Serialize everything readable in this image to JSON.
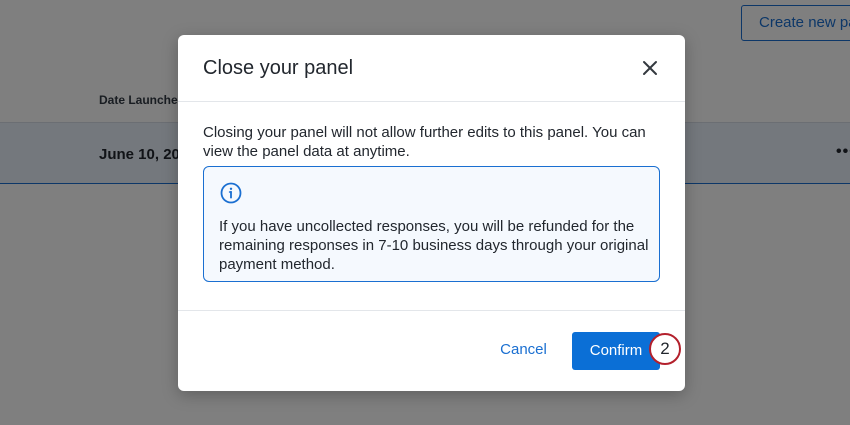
{
  "background": {
    "create_button_label": "Create new pa",
    "column_header": "Date Launche",
    "row_date": "June 10, 20",
    "row_more_label": "•••"
  },
  "modal": {
    "title": "Close your panel",
    "close_icon": "close-x-icon",
    "message": "Closing your panel will not allow further edits to this panel. You can view the panel data at anytime.",
    "info": {
      "icon": "info-circle-icon",
      "text": "If you have uncollected responses, you will be refunded for the remaining responses in 7-10 business days through your original payment method."
    },
    "cancel_label": "Cancel",
    "confirm_label": "Confirm"
  },
  "step_badge": "2",
  "colors": {
    "accent": "#0b6fd6",
    "badge_border": "#b3202c",
    "info_background": "#f5f9fe",
    "row_highlight": "#e8f1fb"
  }
}
